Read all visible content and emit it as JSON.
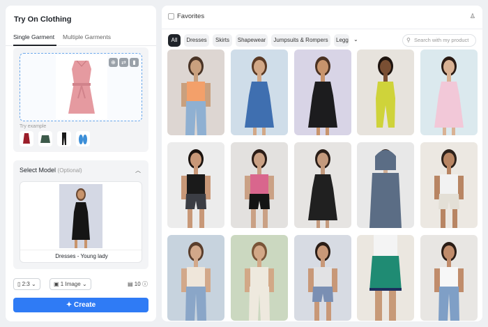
{
  "left": {
    "title": "Try On Clothing",
    "tabs": [
      "Single Garment",
      "Multiple Garments"
    ],
    "try_example_label": "Try example",
    "model_section": {
      "title": "Select Model",
      "optional": "(Optional)",
      "caption": "Dresses - Young lady"
    },
    "aspect_ratio": "2:3",
    "image_count": "1 Image",
    "credits": "10",
    "create_label": "Create"
  },
  "right": {
    "favorites_label": "Favorites",
    "filters": [
      "All",
      "Dresses",
      "Skirts",
      "Shapewear",
      "Jumpsuits & Rompers",
      "Legg"
    ],
    "search_placeholder": "Search with my product"
  },
  "colors": {
    "accent": "#2f7bf5",
    "active_chip": "#1f2329"
  },
  "gallery": [
    {
      "bg": "#ddd6d2",
      "skin": "#c9a07e",
      "hair": "#4a3426",
      "top": "#f3a06a",
      "bottom": "#8fb0d2",
      "style": "top-jeans"
    },
    {
      "bg": "#cfdde9",
      "skin": "#d2a887",
      "hair": "#5a3a25",
      "top": "#3f6fb0",
      "bottom": "#3f6fb0",
      "style": "dress"
    },
    {
      "bg": "#d8d4e6",
      "skin": "#c8946c",
      "hair": "#4b3222",
      "top": "#1c1c1e",
      "bottom": "#1c1c1e",
      "style": "dress"
    },
    {
      "bg": "#e7e3dd",
      "skin": "#7a4f33",
      "hair": "#1e140f",
      "top": "#cfd33a",
      "bottom": "#cfd33a",
      "style": "jumpsuit"
    },
    {
      "bg": "#dbe9ee",
      "skin": "#d9b294",
      "hair": "#2a1b14",
      "top": "#f2c8d8",
      "bottom": "#f5e9b8",
      "style": "kid-dress"
    },
    {
      "bg": "#ececec",
      "skin": "#c89878",
      "hair": "#1c1410",
      "top": "#1a1a1a",
      "bottom": "#3b3d44",
      "style": "top-shorts"
    },
    {
      "bg": "#e3e1df",
      "skin": "#caa185",
      "hair": "#2b1d17",
      "top": "#d9668d",
      "bottom": "#141414",
      "style": "top-skirt"
    },
    {
      "bg": "#e6e4e2",
      "skin": "#c49a7d",
      "hair": "#2a1e18",
      "top": "#202020",
      "bottom": "#d8d8d8",
      "style": "dress"
    },
    {
      "bg": "#e8e8e8",
      "skin": "#d4b196",
      "hair": "#3a2a20",
      "top": "#5b6d85",
      "bottom": "#5b6d85",
      "style": "hoodie"
    },
    {
      "bg": "#ece8e2",
      "skin": "#b88563",
      "hair": "#2d221b",
      "top": "#f2f2f2",
      "bottom": "#e3dfd6",
      "style": "top-shorts"
    },
    {
      "bg": "#c7d3de",
      "skin": "#d2a88a",
      "hair": "#5a3e2c",
      "top": "#efe6da",
      "bottom": "#8aa6c8",
      "style": "top-jeans"
    },
    {
      "bg": "#cbd8c0",
      "skin": "#d2a887",
      "hair": "#7a5538",
      "top": "#eee9de",
      "bottom": "#eee9de",
      "style": "top-pants"
    },
    {
      "bg": "#d7dbe3",
      "skin": "#c89878",
      "hair": "#2a1d16",
      "top": "#e2e2e4",
      "bottom": "#7a8fb3",
      "style": "top-shorts"
    },
    {
      "bg": "#ebe7e0",
      "skin": "#c79a78",
      "hair": "#2a1d16",
      "top": "#1f8b73",
      "bottom": "#1f8b73",
      "style": "skirt-only"
    },
    {
      "bg": "#e8e6e3",
      "skin": "#c08c6b",
      "hair": "#2a1d16",
      "top": "#f7f7f7",
      "bottom": "#7f9fc6",
      "style": "top-jeans"
    }
  ]
}
